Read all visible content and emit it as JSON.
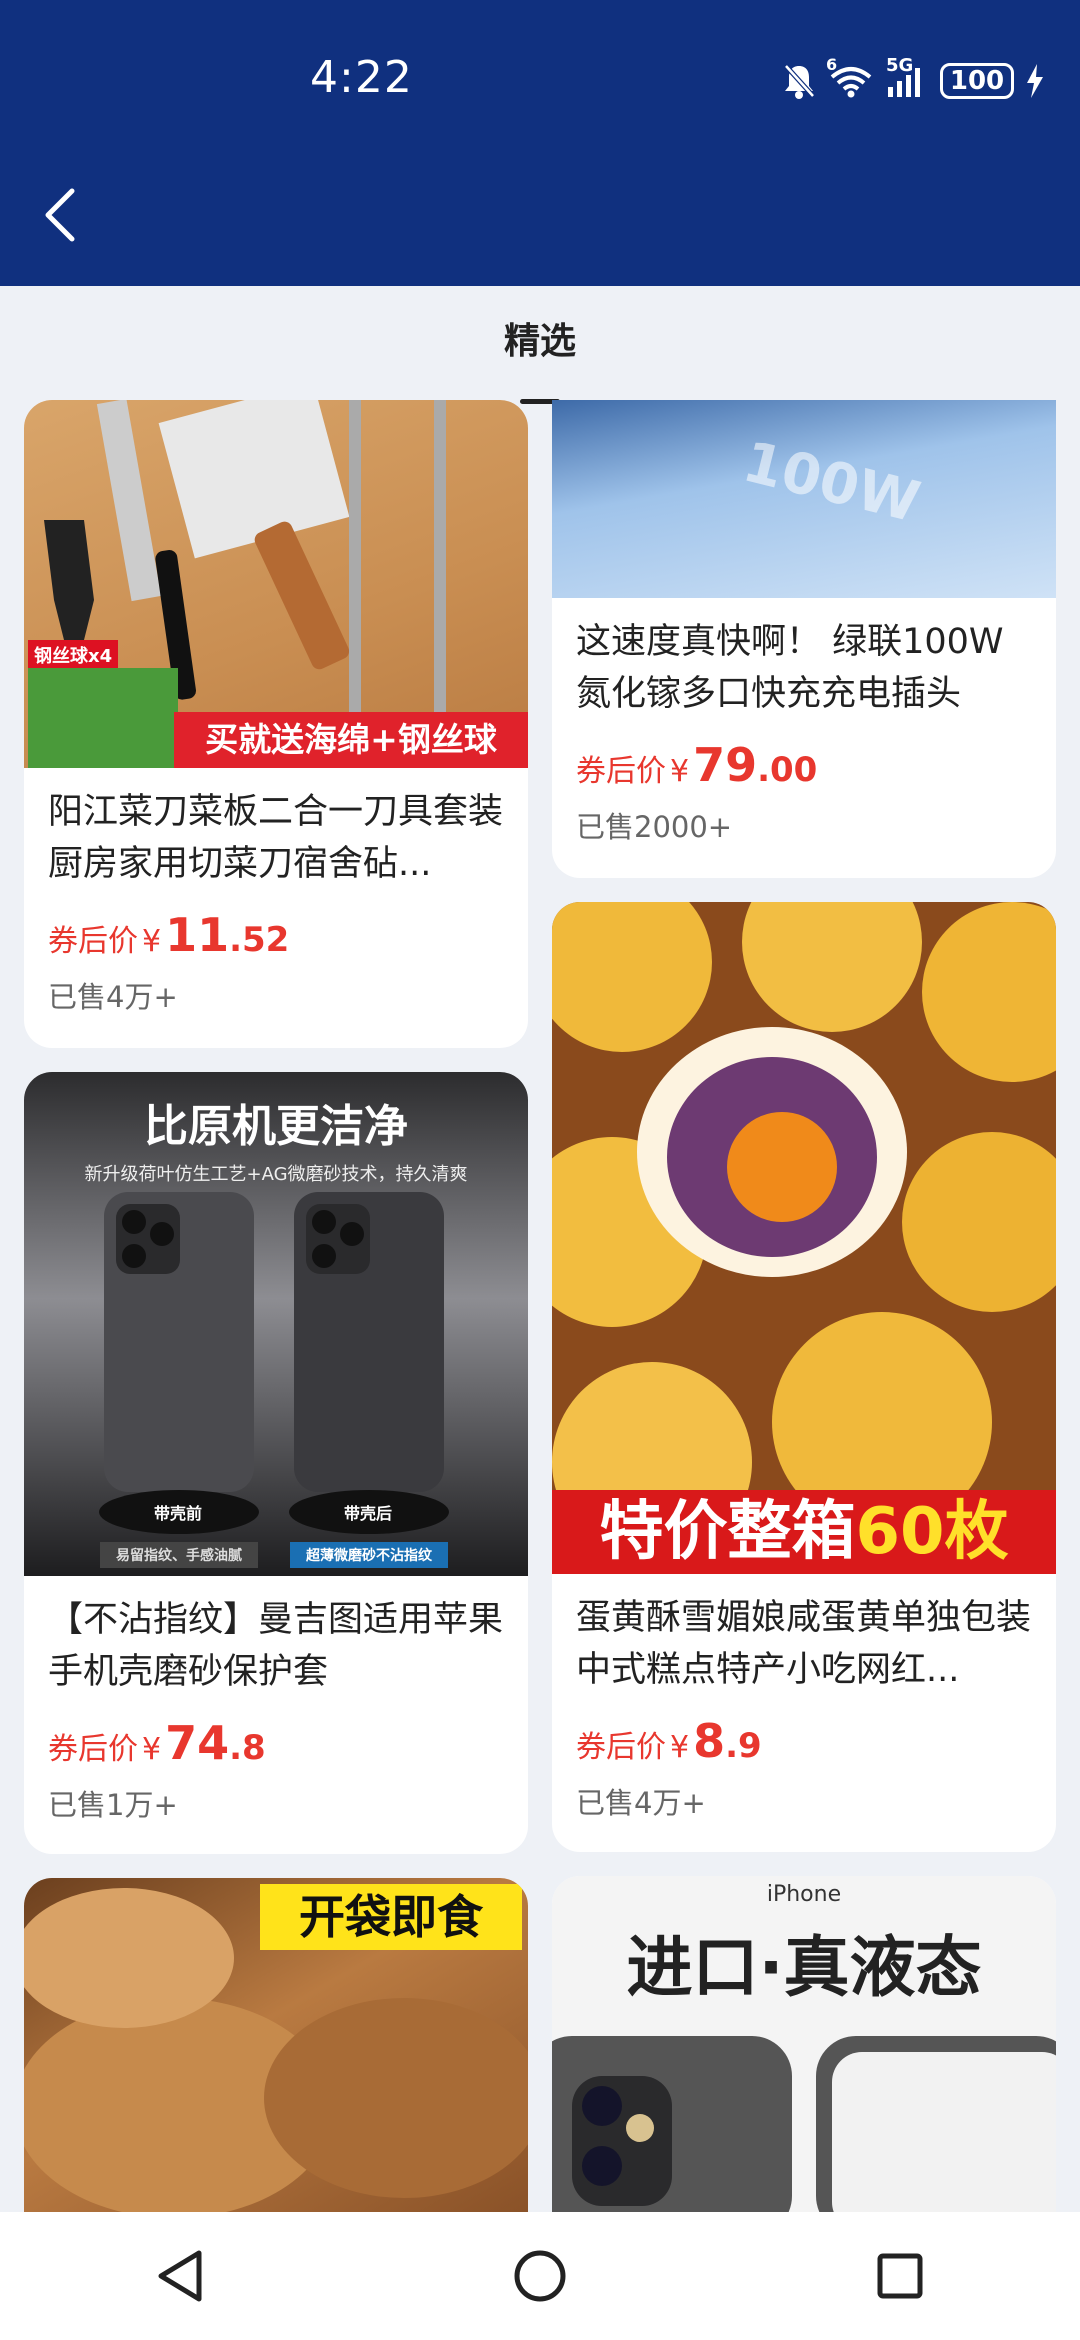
{
  "status": {
    "time": "4:22",
    "battery": "100",
    "network": "5G",
    "wifi_badge": "6"
  },
  "tabs": [
    {
      "label": "精选"
    }
  ],
  "products": [
    {
      "title": "阳江菜刀菜板二合一刀具套装厨房家用切菜刀宿舍砧...",
      "price_label": "券后价",
      "currency": "¥",
      "price_int": "11",
      "price_dec": ".52",
      "sold": "已售4万+",
      "image_text": [
        "钢丝球x4",
        "买就送海绵+钢丝球"
      ]
    },
    {
      "title": "这速度真快啊！ 绿联100W氮化镓多口快充充电插头",
      "price_label": "券后价",
      "currency": "¥",
      "price_int": "79",
      "price_dec": ".00",
      "sold": "已售2000+",
      "image_text": [
        "100W"
      ]
    },
    {
      "title": "【不沾指纹】曼吉图适用苹果手机壳磨砂保护套",
      "price_label": "券后价",
      "currency": "¥",
      "price_int": "74",
      "price_dec": ".8",
      "sold": "已售1万+",
      "image_text": [
        "比原机更洁净",
        "新升级荷叶仿生工艺+AG微磨砂技术，持久清爽",
        "带壳前",
        "带壳后",
        "易留指纹、手感油腻",
        "超薄微磨砂不沾指纹"
      ]
    },
    {
      "title": "蛋黄酥雪媚娘咸蛋黄单独包装中式糕点特产小吃网红...",
      "price_label": "券后价",
      "currency": "¥",
      "price_int": "8",
      "price_dec": ".9",
      "sold": "已售4万+",
      "image_text": [
        "特价整箱",
        "60枚"
      ]
    },
    {
      "image_text": [
        "开袋即食"
      ]
    },
    {
      "image_text": [
        "iPhone",
        "进口·真液态"
      ]
    }
  ],
  "colors": {
    "header": "#10307f",
    "price": "#e8372e",
    "background": "#eef1f6"
  }
}
